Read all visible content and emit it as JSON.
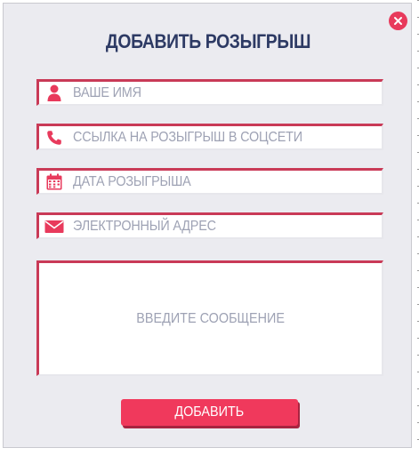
{
  "form": {
    "title": "ДОБАВИТЬ РОЗЫГРЫШ",
    "fields": [
      {
        "icon": "user-icon",
        "placeholder": "ВАШЕ ИМЯ"
      },
      {
        "icon": "phone-icon",
        "placeholder": "ССЫЛКА НА РОЗЫГРЫШ В СОЦСЕТИ"
      },
      {
        "icon": "calendar-icon",
        "placeholder": "ДАТА РОЗЫГРЫША"
      },
      {
        "icon": "mail-icon",
        "placeholder": "ЭЛЕКТРОННЫЙ АДРЕС"
      }
    ],
    "message_placeholder": "ВВЕДИТЕ СООБЩЕНИЕ",
    "submit_label": "ДОБАВИТЬ",
    "close_icon": "close-icon"
  },
  "colors": {
    "accent": "#e83a5c",
    "field_border": "#c93a57",
    "title": "#2d3a64",
    "placeholder": "#9ea2b4",
    "modal_bg": "#ebebf0",
    "button": "#f0395c",
    "button_shadow": "#a82440"
  }
}
